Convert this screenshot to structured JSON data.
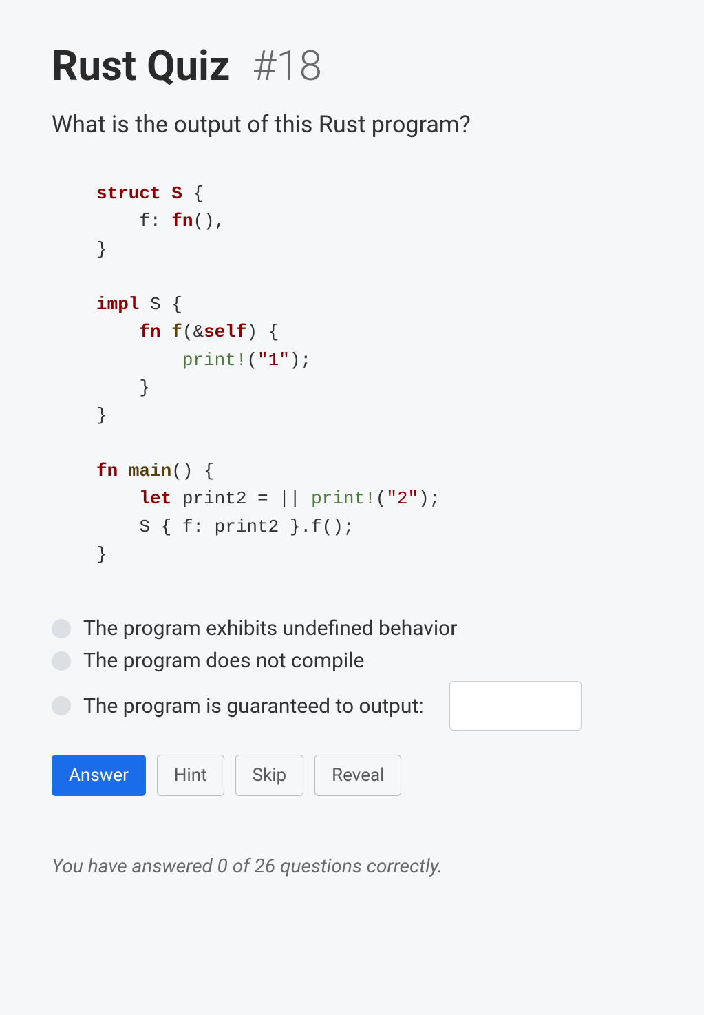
{
  "header": {
    "title": "Rust Quiz",
    "number": "#18"
  },
  "question": "What is the output of this Rust program?",
  "code": {
    "tokens": [
      {
        "t": "kw",
        "v": "struct"
      },
      {
        "t": "",
        "v": " "
      },
      {
        "t": "type",
        "v": "S"
      },
      {
        "t": "",
        "v": " {\n    f: "
      },
      {
        "t": "kw",
        "v": "fn"
      },
      {
        "t": "",
        "v": "(),\n}\n\n"
      },
      {
        "t": "kw",
        "v": "impl"
      },
      {
        "t": "",
        "v": " S {\n    "
      },
      {
        "t": "kw",
        "v": "fn"
      },
      {
        "t": "",
        "v": " "
      },
      {
        "t": "fn-name",
        "v": "f"
      },
      {
        "t": "",
        "v": "(&"
      },
      {
        "t": "self",
        "v": "self"
      },
      {
        "t": "",
        "v": ") {\n        "
      },
      {
        "t": "macro",
        "v": "print!"
      },
      {
        "t": "",
        "v": "("
      },
      {
        "t": "string",
        "v": "\"1\""
      },
      {
        "t": "",
        "v": ");\n    }\n}\n\n"
      },
      {
        "t": "kw",
        "v": "fn"
      },
      {
        "t": "",
        "v": " "
      },
      {
        "t": "fn-name",
        "v": "main"
      },
      {
        "t": "",
        "v": "() {\n    "
      },
      {
        "t": "kw",
        "v": "let"
      },
      {
        "t": "",
        "v": " print2 = || "
      },
      {
        "t": "macro",
        "v": "print!"
      },
      {
        "t": "",
        "v": "("
      },
      {
        "t": "string",
        "v": "\"2\""
      },
      {
        "t": "",
        "v": ");\n    S { f: print2 }.f();\n}"
      }
    ]
  },
  "options": {
    "undefined": "The program exhibits undefined behavior",
    "no_compile": "The program does not compile",
    "output": "The program is guaranteed to output:"
  },
  "output_value": "",
  "buttons": {
    "answer": "Answer",
    "hint": "Hint",
    "skip": "Skip",
    "reveal": "Reveal"
  },
  "score": {
    "prefix": "You have answered ",
    "correct": "0",
    "mid": " of ",
    "total": "26",
    "suffix": " questions correctly."
  }
}
